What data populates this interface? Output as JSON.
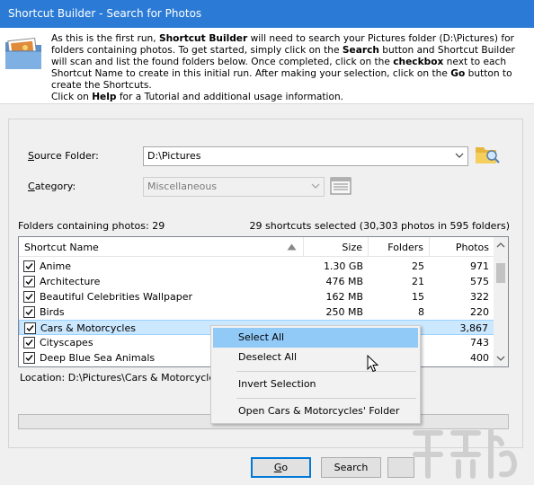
{
  "window": {
    "title": "Shortcut Builder - Search for Photos"
  },
  "intro": {
    "p1": "As this is the first run, ",
    "b1": "Shortcut Builder",
    "p2": " will need to search your Pictures folder (D:\\Pictures) for folders containing photos.  To get started, simply click on the ",
    "b2": "Search",
    "p3": " button and Shortcut Builder will scan and list the found folders below.  Once completed, click on the ",
    "b3": "checkbox",
    "p4": " next to each Shortcut Name to create in this initial run.  After making your selection, click on the ",
    "b4": "Go",
    "p5": " button to create the Shortcuts.",
    "p6": "Click on ",
    "b5": "Help",
    "p7": " for a Tutorial and additional usage information."
  },
  "form": {
    "source_label_first": "S",
    "source_label_rest": "ource Folder:",
    "source_value": "D:\\Pictures",
    "category_label_first": "C",
    "category_label_rest": "ategory:",
    "category_value": "Miscellaneous"
  },
  "summary": {
    "left": "Folders containing photos: 29",
    "right": "29 shortcuts selected (30,303 photos in 595 folders)"
  },
  "table": {
    "headers": {
      "name": "Shortcut Name",
      "size": "Size",
      "folders": "Folders",
      "photos": "Photos"
    },
    "rows": [
      {
        "name": "Anime",
        "size": "1.30 GB",
        "folders": "25",
        "photos": "971",
        "checked": true
      },
      {
        "name": "Architecture",
        "size": "476 MB",
        "folders": "21",
        "photos": "575",
        "checked": true
      },
      {
        "name": "Beautiful Celebrities Wallpaper",
        "size": "162 MB",
        "folders": "15",
        "photos": "322",
        "checked": true
      },
      {
        "name": "Birds",
        "size": "250 MB",
        "folders": "8",
        "photos": "220",
        "checked": true
      },
      {
        "name": "Cars & Motorcycles",
        "size": "",
        "folders": "",
        "photos": "3,867",
        "checked": true
      },
      {
        "name": "Cityscapes",
        "size": "",
        "folders": "",
        "photos": "743",
        "checked": true
      },
      {
        "name": "Deep Blue Sea Animals",
        "size": "",
        "folders": "",
        "photos": "400",
        "checked": true
      }
    ]
  },
  "location": "Location: D:\\Pictures\\Cars & Motorcycles",
  "progress": 0,
  "buttons": {
    "go_first": "G",
    "go_rest": "o",
    "search": "Search"
  },
  "context_menu": {
    "items": [
      "Select All",
      "Deselect All",
      "Invert Selection",
      "Open Cars & Motorcycles' Folder"
    ]
  },
  "colors": {
    "titlebar": "#2b7bd6",
    "selection": "#cce8ff",
    "menu_highlight": "#91c9f7"
  }
}
